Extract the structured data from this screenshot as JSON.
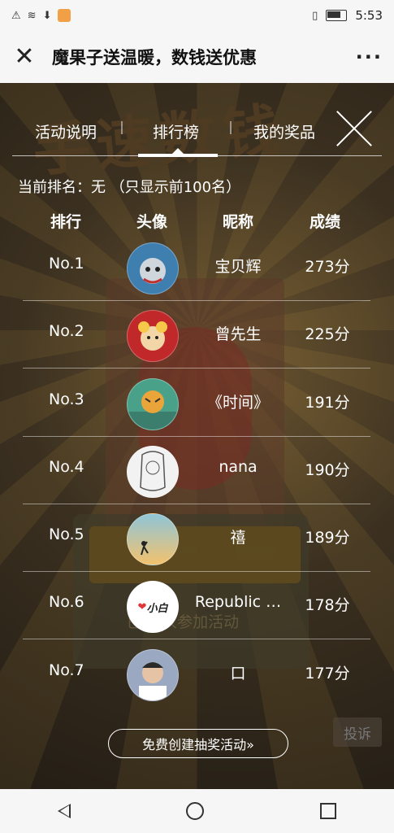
{
  "status_bar": {
    "time": "5:53"
  },
  "header": {
    "title": "魔果子送温暖，数钱送优惠",
    "more_label": "···",
    "close_label": "✕"
  },
  "tabs": [
    {
      "label": "活动说明",
      "active": false
    },
    {
      "label": "排行榜",
      "active": true
    },
    {
      "label": "我的奖品",
      "active": false
    }
  ],
  "rank_info": "当前排名：无 （只显示前100名）",
  "table_headers": {
    "rank": "排行",
    "avatar": "头像",
    "nickname": "昵称",
    "score": "成绩"
  },
  "rows": [
    {
      "rank": "No.1",
      "nickname": "宝贝辉",
      "score": "273分",
      "avatar_color": "#3f7fb0"
    },
    {
      "rank": "No.2",
      "nickname": "曾先生",
      "score": "225分",
      "avatar_color": "#c0282a"
    },
    {
      "rank": "No.3",
      "nickname": "《时间》",
      "score": "191分",
      "avatar_color": "#4aa18a"
    },
    {
      "rank": "No.4",
      "nickname": "nana",
      "score": "190分",
      "avatar_color": "#f2f2f2"
    },
    {
      "rank": "No.5",
      "nickname": "禧",
      "score": "189分",
      "avatar_color": "#f3c26d"
    },
    {
      "rank": "No.6",
      "nickname": "Republic …",
      "score": "178分",
      "avatar_color": "#ffffff",
      "avatar_text": "小白"
    },
    {
      "rank": "No.7",
      "nickname": "口",
      "score": "177分",
      "avatar_color": "#9aa8c2"
    }
  ],
  "background_text": {
    "big": "手速数钱",
    "participants": "已 3 人参加活动"
  },
  "bottom": {
    "create_button": "免费创建抽奖活动»",
    "complain": "投诉"
  },
  "colors": {
    "accent_red": "#e0383a",
    "text": "#ffffff"
  }
}
